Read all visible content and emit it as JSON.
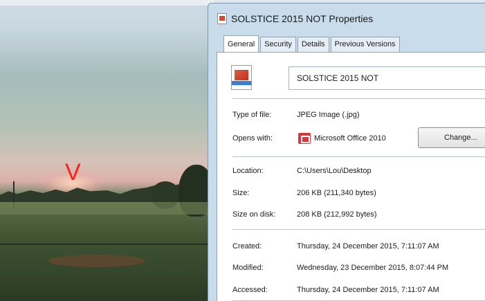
{
  "dialog": {
    "title": "SOLSTICE 2015 NOT Properties",
    "tabs": [
      "General",
      "Security",
      "Details",
      "Previous Versions"
    ],
    "active_tab": "General",
    "file_name": "SOLSTICE 2015 NOT",
    "type_label": "Type of file:",
    "type_value": "JPEG Image (.jpg)",
    "opens_label": "Opens with:",
    "opens_value": "Microsoft Office 2010",
    "change_button": "Change...",
    "location_label": "Location:",
    "location_value": "C:\\Users\\Lou\\Desktop",
    "size_label": "Size:",
    "size_value": "206 KB (211,340 bytes)",
    "size_on_disk_label": "Size on disk:",
    "size_on_disk_value": "208 KB (212,992 bytes)",
    "created_label": "Created:",
    "created_value": "Thursday, 24 December 2015, 7:11:07 AM",
    "modified_label": "Modified:",
    "modified_value": "Wednesday, 23 December 2015, 8:07:44 PM",
    "accessed_label": "Accessed:",
    "accessed_value": "Thursday, 24 December 2015, 7:11:07 AM"
  },
  "photo": {
    "marker_text": "V",
    "marker_color": "#ff2020"
  },
  "icons": {
    "title_icon": "jpeg-file-icon",
    "file_icon": "jpeg-file-icon",
    "opens_icon": "microsoft-office-icon"
  }
}
